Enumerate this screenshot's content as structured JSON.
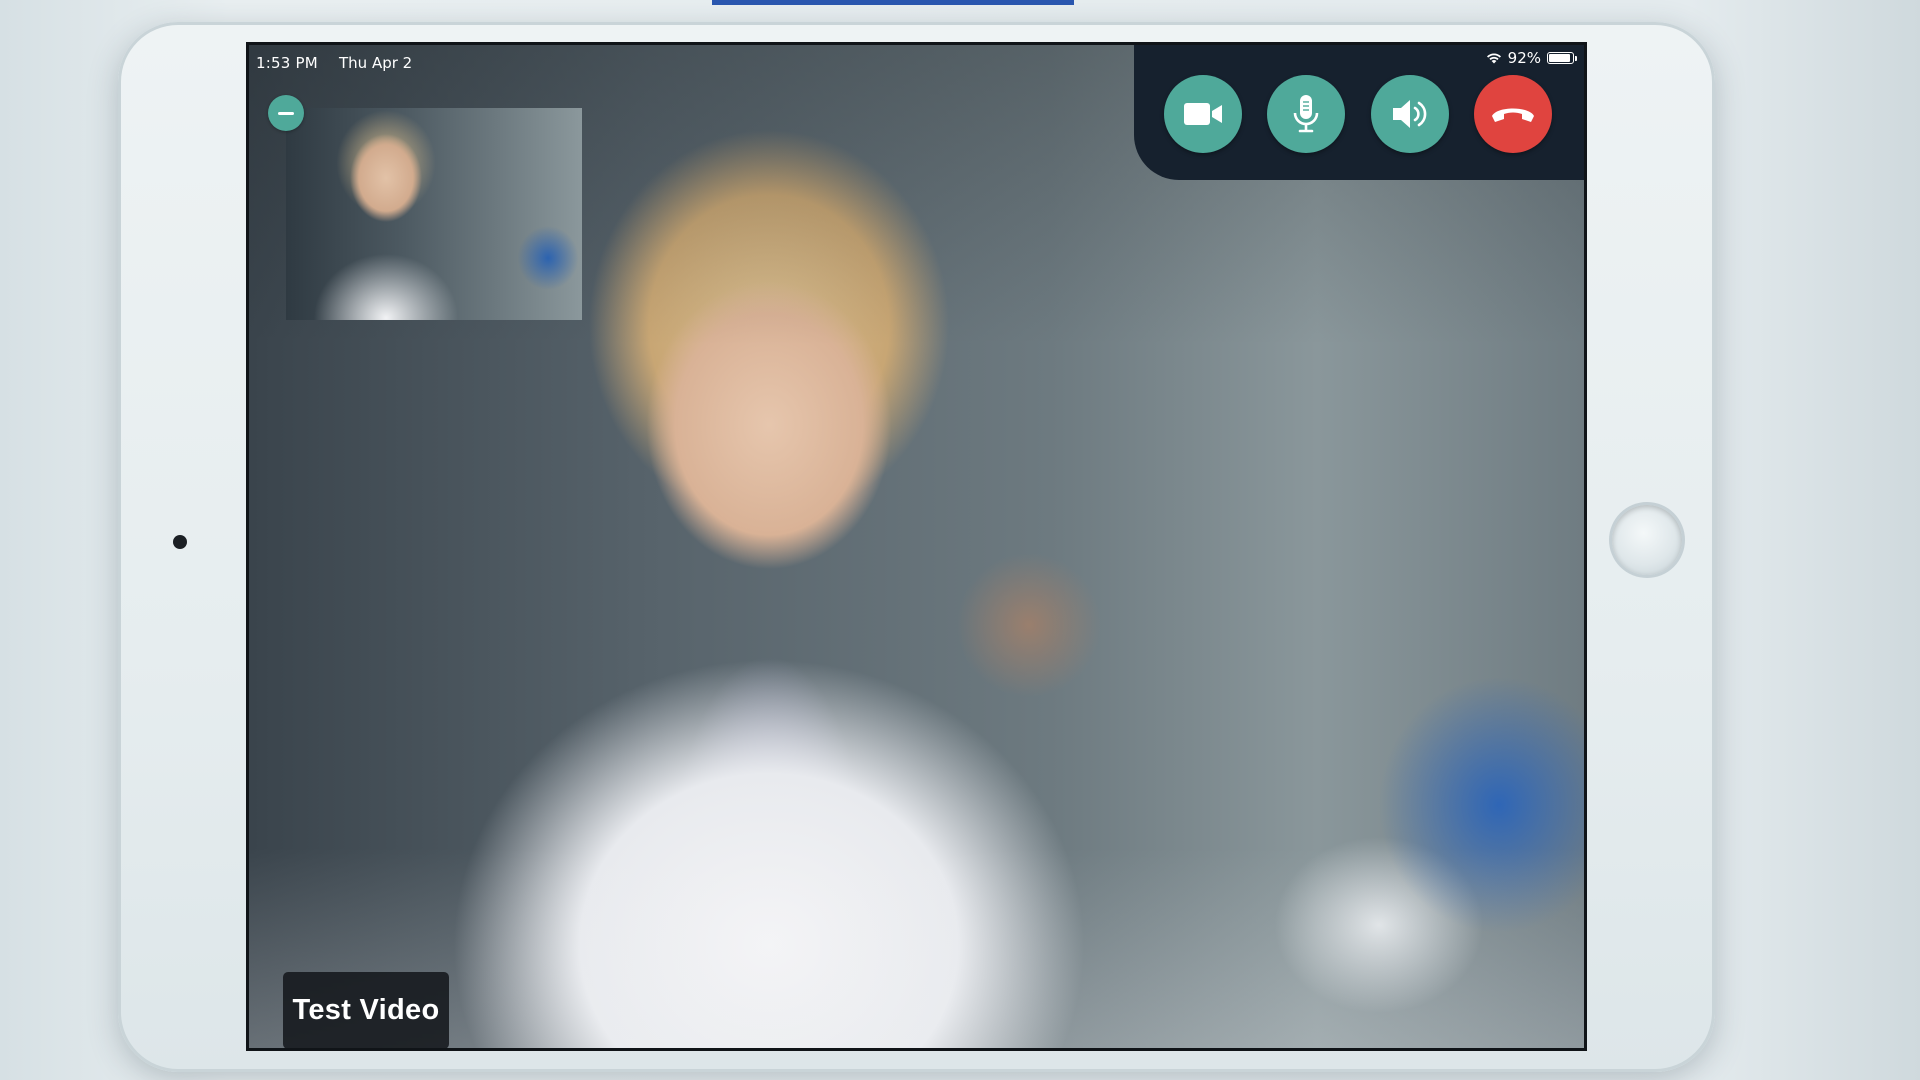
{
  "status_bar": {
    "time": "1:53 PM",
    "date": "Thu Apr 2",
    "battery_percent": "92%",
    "battery_level": 0.92,
    "wifi_icon": "wifi-icon"
  },
  "controls": {
    "video_icon": "video-camera-icon",
    "mic_icon": "microphone-icon",
    "speaker_icon": "speaker-icon",
    "hangup_icon": "hang-up-icon",
    "accent_color": "#4fa99a",
    "end_call_color": "#e0443f",
    "panel_color": "#16212e"
  },
  "self_view": {
    "minimize_icon": "minus-icon"
  },
  "overlay_label": "Test Video"
}
